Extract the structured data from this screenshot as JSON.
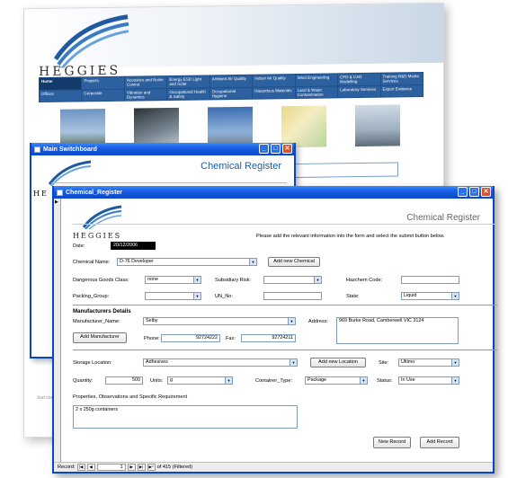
{
  "website": {
    "brand": "HEGGIES",
    "nav_row1": [
      "Home",
      "Projects",
      "Acoustics and Noise Control",
      "Energy ESD Light and Solar",
      "Ambient Air Quality",
      "Indoor Air Quality",
      "Wind Engineering",
      "CFD & CAD Modelling",
      "Training R&D Media Services"
    ],
    "nav_row2": [
      "Offices",
      "Corporate",
      "Vibration and Dynamics",
      "Occupational Health & Safety",
      "Occupational Hygiene",
      "Hazardous Materials",
      "Land & Water Contamination",
      "Laboratory Services",
      "Expert Evidence"
    ],
    "footer_text": "Staf corp osse"
  },
  "switchboard": {
    "title": "Main Switchboard",
    "heading": "Chemical Register",
    "brand_partial": "HE"
  },
  "chem_form": {
    "title": "Chemical_Register",
    "heading": "Chemical Register",
    "brand": "HEGGIES",
    "instructions": "Please add the relevant information into the form and select the submit button below.",
    "date_label": "Date:",
    "date_value": "20/12/2006",
    "chemical_name_label": "Chemical Name:",
    "chemical_name_value": "D-76 Developer",
    "add_chemical_button": "Add new Chemical",
    "dg_class_label": "Dangerous Goods Class:",
    "dg_class_value": "none",
    "subsidiary_risk_label": "Subsidiary Risk:",
    "subsidiary_risk_value": "",
    "hazchem_label": "Hazchem Code:",
    "hazchem_value": "",
    "packing_group_label": "Packing_Group:",
    "packing_group_value": "",
    "un_no_label": "UN_No:",
    "un_no_value": "",
    "state_label": "State:",
    "state_value": "Liquid",
    "manufacturers_heading": "Manufacturers Details",
    "manufacturer_name_label": "Manufacturer_Name:",
    "manufacturer_name_value": "Selby",
    "address_label": "Address:",
    "address_value": "969 Burke Road, Camberwell VIC 3124",
    "add_manufacturer_button": "Add Manufacturer",
    "phone_label": "Phone:",
    "phone_value": "92724222",
    "fax_label": "Fax:",
    "fax_value": "92724211",
    "storage_location_label": "Storage Location:",
    "storage_location_value": "Adhesives",
    "add_location_button": "Add new Location",
    "site_label": "Site:",
    "site_value": "Ultimo",
    "quantity_label": "Quantity:",
    "quantity_value": "500",
    "units_label": "Units:",
    "units_value": "g",
    "container_type_label": "Container_Type:",
    "container_type_value": "Package",
    "status_label": "Status:",
    "status_value": "In Use",
    "properties_label": "Properties, Observations and Specific Requirement",
    "properties_value": "2 x 250g containers",
    "new_record_button": "New Record",
    "add_record_button": "Add Record",
    "record_label": "Record:",
    "record_number": "1",
    "record_total": "of 415 (Filtered)"
  },
  "colors": {
    "title_bar": "#0a46c8",
    "nav_blue": "#1f4f8a",
    "heading_blue": "#1a5fa8"
  }
}
